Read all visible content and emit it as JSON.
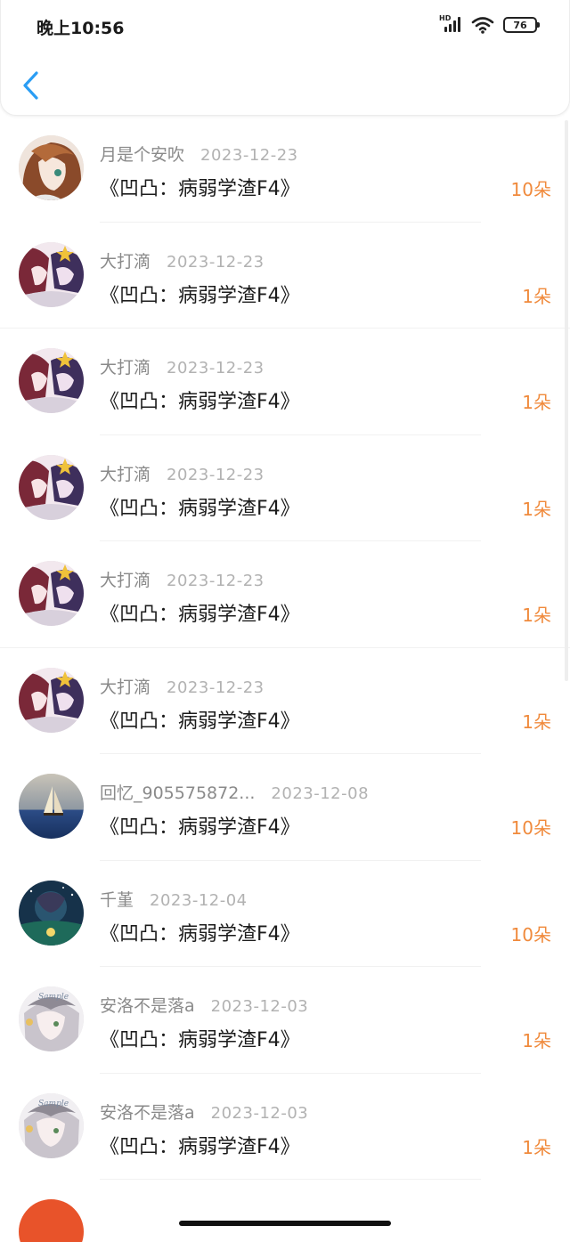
{
  "status_bar": {
    "time": "晚上10:56",
    "network": "HD",
    "battery": "76"
  },
  "colors": {
    "accent_back": "#2a9df4",
    "count": "#f08a3c"
  },
  "rows": [
    {
      "user": "月是个安吹",
      "date": "2023-12-23",
      "title": "《凹凸：病弱学渣F4》",
      "count": "10朵",
      "avatar": "anime-brown-hair"
    },
    {
      "user": "大打滴",
      "date": "2023-12-23",
      "title": "《凹凸：病弱学渣F4》",
      "count": "1朵",
      "avatar": "anime-group"
    },
    {
      "user": "大打滴",
      "date": "2023-12-23",
      "title": "《凹凸：病弱学渣F4》",
      "count": "1朵",
      "avatar": "anime-group"
    },
    {
      "user": "大打滴",
      "date": "2023-12-23",
      "title": "《凹凸：病弱学渣F4》",
      "count": "1朵",
      "avatar": "anime-group"
    },
    {
      "user": "大打滴",
      "date": "2023-12-23",
      "title": "《凹凸：病弱学渣F4》",
      "count": "1朵",
      "avatar": "anime-group"
    },
    {
      "user": "大打滴",
      "date": "2023-12-23",
      "title": "《凹凸：病弱学渣F4》",
      "count": "1朵",
      "avatar": "anime-group"
    },
    {
      "user": "回忆_905575872...",
      "date": "2023-12-08",
      "title": "《凹凸：病弱学渣F4》",
      "count": "10朵",
      "avatar": "sailboat"
    },
    {
      "user": "千堇",
      "date": "2023-12-04",
      "title": "《凹凸：病弱学渣F4》",
      "count": "10朵",
      "avatar": "night-scene"
    },
    {
      "user": "安洛不是落a",
      "date": "2023-12-03",
      "title": "《凹凸：病弱学渣F4》",
      "count": "1朵",
      "avatar": "anime-sample"
    },
    {
      "user": "安洛不是落a",
      "date": "2023-12-03",
      "title": "《凹凸：病弱学渣F4》",
      "count": "1朵",
      "avatar": "anime-sample"
    }
  ]
}
